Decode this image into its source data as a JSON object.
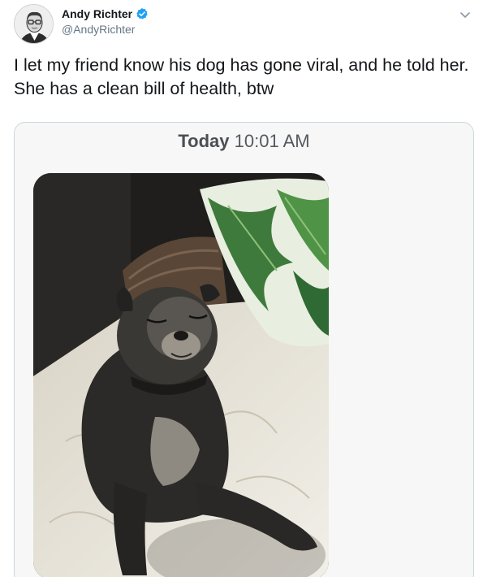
{
  "author": {
    "display_name": "Andy Richter",
    "handle": "@AndyRichter",
    "verified": true
  },
  "icons": {
    "verified": "verified-badge-icon",
    "caret": "chevron-down-icon"
  },
  "tweet": {
    "text": "I let my friend know his dog has gone viral, and he told her. She has a clean bill of health, btw"
  },
  "media": {
    "timestamp_day": "Today",
    "timestamp_time": "10:01 AM"
  },
  "colors": {
    "verified": "#1da1f2",
    "handle": "#657786",
    "border": "#ccd6dd"
  }
}
